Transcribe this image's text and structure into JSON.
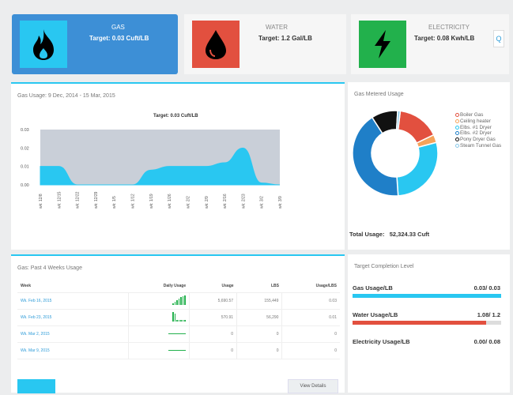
{
  "tiles": [
    {
      "name": "GAS",
      "target": "Target: 0.03 Cuft/LB",
      "color": "#29c7f1",
      "active": true,
      "icon": "flame-icon"
    },
    {
      "name": "WATER",
      "target": "Target: 1.2 Gal/LB",
      "color": "#e2503f",
      "active": false,
      "icon": "droplet-icon"
    },
    {
      "name": "ELECTRICITY",
      "target": "Target: 0.08 Kwh/LB",
      "color": "#22b14c",
      "active": false,
      "icon": "lightning-icon"
    }
  ],
  "more_button": "Q",
  "usage_panel": {
    "title": "Gas Usage: 9 Dec, 2014 - 15 Mar, 2015",
    "chart_title": "Target: 0.03 Cuft/LB"
  },
  "chart_data": [
    {
      "type": "area",
      "title": "Target: 0.03 Cuft/LB",
      "x": [
        "wk: 12/8",
        "wk: 12/15",
        "wk: 12/22",
        "wk: 12/29",
        "wk: 1/5",
        "wk: 1/12",
        "wk: 1/19",
        "wk: 1/26",
        "wk: 2/2",
        "wk: 2/9",
        "wk: 2/16",
        "wk: 2/23",
        "wk: 3/2",
        "wk: 3/9"
      ],
      "y_ticks": [
        "0.03",
        "0.02",
        "0.01",
        "0.00"
      ],
      "ylim": [
        0,
        0.03
      ],
      "series": [
        {
          "values": [
            0.01,
            0.01,
            0,
            0,
            0,
            0,
            0.008,
            0.01,
            0.01,
            0.01,
            0.012,
            0.02,
            0.001,
            0
          ]
        }
      ],
      "colors": {
        "area": "#c9cfd8",
        "line": "#29c7f1"
      }
    },
    {
      "type": "pie",
      "title": "Gas Metered Usage",
      "slices": [
        {
          "label": "Boiler Gas",
          "value": 16,
          "color": "#e2503f"
        },
        {
          "label": "Ceiling heater",
          "value": 3,
          "color": "#f5a35a"
        },
        {
          "label": "Elbs. #1 Dryer",
          "value": 28,
          "color": "#29c7f1"
        },
        {
          "label": "Elbs. #2 Dryer",
          "value": 42,
          "color": "#1f7fc8"
        },
        {
          "label": "Pony Dryer Gas",
          "value": 10,
          "color": "#111111"
        },
        {
          "label": "Steam Tunnel Gas",
          "value": 1,
          "color": "#88c8e8"
        }
      ]
    }
  ],
  "metered_panel": {
    "title": "Gas Metered Usage",
    "legend": [
      "Boiler Gas",
      "Ceiling heater",
      "Elbs. #1 Dryer",
      "Elbs. #2 Dryer",
      "Pony Dryer Gas",
      "Steam Tunnel Gas"
    ],
    "total_label": "Total Usage:",
    "total_value": "52,324.33 Cuft"
  },
  "weeks_panel": {
    "title": "Gas: Past 4 Weeks Usage",
    "columns": [
      "Week",
      "Daily Usage",
      "Usage",
      "LBS",
      "Usage/LBS"
    ],
    "rows": [
      {
        "week": "Wk. Feb 16, 2015",
        "usage": "5,690.57",
        "lbs": "155,449",
        "ratio": "0.03",
        "spark": [
          2,
          4,
          6,
          8,
          10,
          11,
          12
        ]
      },
      {
        "week": "Wk. Feb 23, 2015",
        "usage": "570.91",
        "lbs": "56,290",
        "ratio": "0.01",
        "spark": [
          12,
          10,
          2,
          2,
          2,
          2,
          2
        ]
      },
      {
        "week": "Wk. Mar 2, 2015",
        "usage": "0",
        "lbs": "0",
        "ratio": "0",
        "spark": []
      },
      {
        "week": "Wk. Mar 9, 2015",
        "usage": "0",
        "lbs": "0",
        "ratio": "0",
        "spark": []
      }
    ],
    "details_button": "View Details"
  },
  "target_panel": {
    "title": "Target Completion Level",
    "bars": [
      {
        "label": "Gas Usage/LB",
        "value": "0.03/ 0.03",
        "fraction": 1.0,
        "color": "#29c7f1"
      },
      {
        "label": "Water Usage/LB",
        "value": "1.08/ 1.2",
        "fraction": 0.9,
        "color": "#e2503f"
      },
      {
        "label": "Electricity Usage/LB",
        "value": "0.00/ 0.08",
        "fraction": 0.0,
        "color": "#22b14c"
      }
    ]
  }
}
